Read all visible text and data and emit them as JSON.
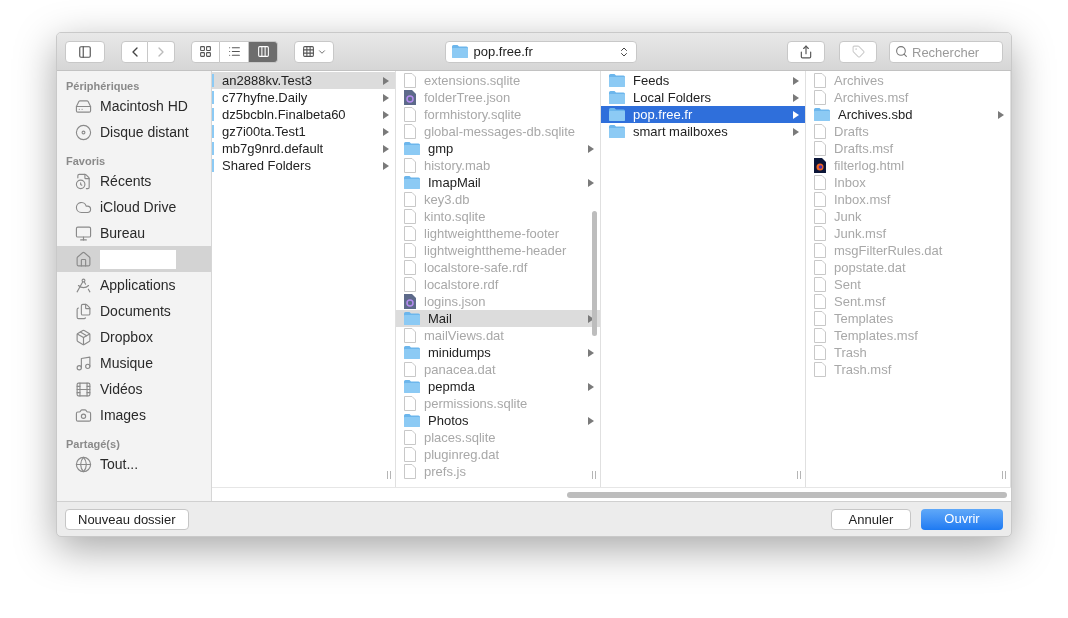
{
  "toolbar": {
    "back": {
      "disabled": false
    },
    "forward": {
      "disabled": true
    },
    "views": [
      {
        "selected": false
      },
      {
        "selected": false
      },
      {
        "selected": true
      }
    ],
    "path": "pop.free.fr",
    "tag": {
      "disabled": true
    },
    "search": {
      "placeholder": "Rechercher"
    }
  },
  "sidebar": [
    {
      "heading": "Périphériques",
      "items": [
        {
          "label": "Macintosh HD",
          "selected": false
        },
        {
          "label": "Disque distant",
          "selected": false
        }
      ]
    },
    {
      "heading": "Favoris",
      "items": [
        {
          "label": "Récents",
          "selected": false
        },
        {
          "label": "iCloud Drive",
          "selected": false
        },
        {
          "label": "Bureau",
          "selected": false
        },
        {
          "redacted": true,
          "selected": true
        },
        {
          "label": "Applications",
          "selected": false
        },
        {
          "label": "Documents",
          "selected": false
        },
        {
          "label": "Dropbox",
          "selected": false
        },
        {
          "label": "Musique",
          "selected": false
        },
        {
          "label": "Vidéos",
          "selected": false
        },
        {
          "label": "Images",
          "selected": false
        }
      ]
    },
    {
      "heading": "Partagé(s)",
      "items": [
        {
          "label": "Tout...",
          "selected": false
        }
      ]
    }
  ],
  "columns": [
    {
      "focused": false,
      "scrolled": true,
      "items": [
        {
          "name": "an2888kv.Test3",
          "kind": "folder",
          "disabled": false,
          "selected": true
        },
        {
          "name": "c77hyfne.Daily",
          "kind": "folder",
          "disabled": false,
          "selected": false
        },
        {
          "name": "dz5bcbln.Finalbeta60",
          "kind": "folder",
          "disabled": false,
          "selected": false
        },
        {
          "name": "gz7i00ta.Test1",
          "kind": "folder",
          "disabled": false,
          "selected": false
        },
        {
          "name": "mb7g9nrd.default",
          "kind": "folder",
          "disabled": false,
          "selected": false
        },
        {
          "name": "Shared Folders",
          "kind": "folder",
          "disabled": false,
          "selected": false
        }
      ]
    },
    {
      "focused": false,
      "scrolled": false,
      "items": [
        {
          "name": "extensions.sqlite",
          "kind": "file",
          "disabled": true,
          "selected": false
        },
        {
          "name": "folderTree.json",
          "kind": "json",
          "disabled": true,
          "selected": false
        },
        {
          "name": "formhistory.sqlite",
          "kind": "file",
          "disabled": true,
          "selected": false
        },
        {
          "name": "global-messages-db.sqlite",
          "kind": "file",
          "disabled": true,
          "selected": false
        },
        {
          "name": "gmp",
          "kind": "folder",
          "disabled": false,
          "selected": false
        },
        {
          "name": "history.mab",
          "kind": "file",
          "disabled": true,
          "selected": false
        },
        {
          "name": "ImapMail",
          "kind": "folder",
          "disabled": false,
          "selected": false
        },
        {
          "name": "key3.db",
          "kind": "file",
          "disabled": true,
          "selected": false
        },
        {
          "name": "kinto.sqlite",
          "kind": "file",
          "disabled": true,
          "selected": false
        },
        {
          "name": "lightweighttheme-footer",
          "kind": "file",
          "disabled": true,
          "selected": false
        },
        {
          "name": "lightweighttheme-header",
          "kind": "file",
          "disabled": true,
          "selected": false
        },
        {
          "name": "localstore-safe.rdf",
          "kind": "file",
          "disabled": true,
          "selected": false
        },
        {
          "name": "localstore.rdf",
          "kind": "file",
          "disabled": true,
          "selected": false
        },
        {
          "name": "logins.json",
          "kind": "json",
          "disabled": true,
          "selected": false
        },
        {
          "name": "Mail",
          "kind": "folder",
          "disabled": false,
          "selected": true
        },
        {
          "name": "mailViews.dat",
          "kind": "file",
          "disabled": true,
          "selected": false
        },
        {
          "name": "minidumps",
          "kind": "folder",
          "disabled": false,
          "selected": false
        },
        {
          "name": "panacea.dat",
          "kind": "file",
          "disabled": true,
          "selected": false
        },
        {
          "name": "pepmda",
          "kind": "folder",
          "disabled": false,
          "selected": false
        },
        {
          "name": "permissions.sqlite",
          "kind": "file",
          "disabled": true,
          "selected": false
        },
        {
          "name": "Photos",
          "kind": "folder",
          "disabled": false,
          "selected": false
        },
        {
          "name": "places.sqlite",
          "kind": "file",
          "disabled": true,
          "selected": false
        },
        {
          "name": "pluginreg.dat",
          "kind": "file",
          "disabled": true,
          "selected": false
        },
        {
          "name": "prefs.js",
          "kind": "file",
          "disabled": true,
          "selected": false
        }
      ]
    },
    {
      "focused": true,
      "scrolled": false,
      "items": [
        {
          "name": "Feeds",
          "kind": "folder",
          "disabled": false,
          "selected": false
        },
        {
          "name": "Local Folders",
          "kind": "folder",
          "disabled": false,
          "selected": false
        },
        {
          "name": "pop.free.fr",
          "kind": "folder",
          "disabled": false,
          "selected": true
        },
        {
          "name": "smart mailboxes",
          "kind": "folder",
          "disabled": false,
          "selected": false
        }
      ]
    },
    {
      "scrolled": false,
      "items": [
        {
          "name": "Archives",
          "kind": "file",
          "disabled": true,
          "selected": false
        },
        {
          "name": "Archives.msf",
          "kind": "file",
          "disabled": true,
          "selected": false
        },
        {
          "name": "Archives.sbd",
          "kind": "folder",
          "disabled": false,
          "selected": false
        },
        {
          "name": "Drafts",
          "kind": "file",
          "disabled": true,
          "selected": false
        },
        {
          "name": "Drafts.msf",
          "kind": "file",
          "disabled": true,
          "selected": false
        },
        {
          "name": "filterlog.html",
          "kind": "html",
          "disabled": true,
          "selected": false
        },
        {
          "name": "Inbox",
          "kind": "file",
          "disabled": true,
          "selected": false
        },
        {
          "name": "Inbox.msf",
          "kind": "file",
          "disabled": true,
          "selected": false
        },
        {
          "name": "Junk",
          "kind": "file",
          "disabled": true,
          "selected": false
        },
        {
          "name": "Junk.msf",
          "kind": "file",
          "disabled": true,
          "selected": false
        },
        {
          "name": "msgFilterRules.dat",
          "kind": "file",
          "disabled": true,
          "selected": false
        },
        {
          "name": "popstate.dat",
          "kind": "file",
          "disabled": true,
          "selected": false
        },
        {
          "name": "Sent",
          "kind": "file",
          "disabled": true,
          "selected": false
        },
        {
          "name": "Sent.msf",
          "kind": "file",
          "disabled": true,
          "selected": false
        },
        {
          "name": "Templates",
          "kind": "file",
          "disabled": true,
          "selected": false
        },
        {
          "name": "Templates.msf",
          "kind": "file",
          "disabled": true,
          "selected": false
        },
        {
          "name": "Trash",
          "kind": "file",
          "disabled": true,
          "selected": false
        },
        {
          "name": "Trash.msf",
          "kind": "file",
          "disabled": true,
          "selected": false
        }
      ]
    }
  ],
  "buttons": [
    {
      "label": "Nouveau dossier",
      "kind": "secondary"
    },
    {
      "label": "Annuler",
      "kind": "secondary"
    },
    {
      "label": "Ouvrir",
      "kind": "primary"
    }
  ]
}
